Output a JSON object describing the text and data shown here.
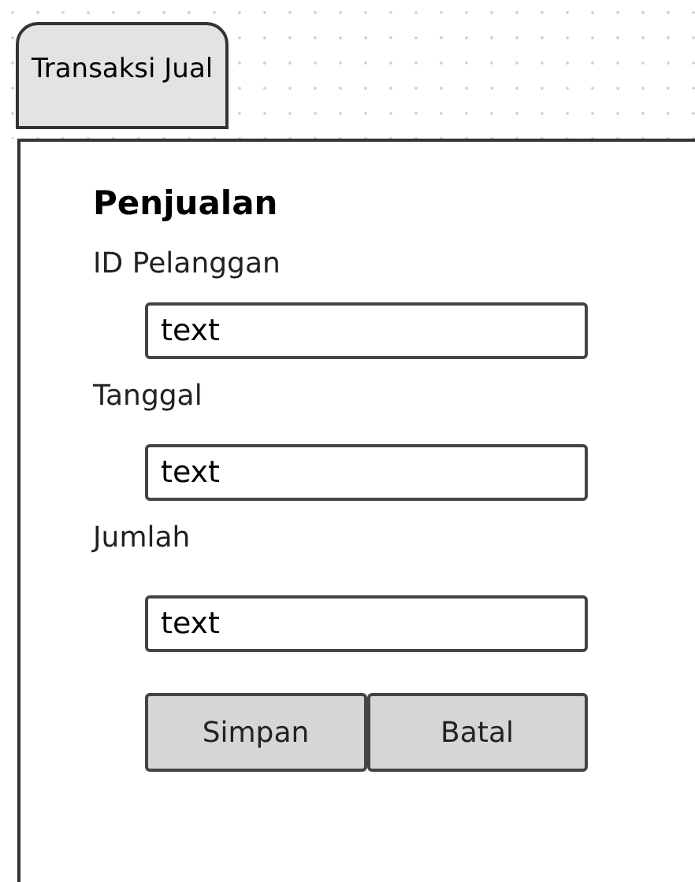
{
  "tabs": [
    {
      "label": "Transaksi Jual",
      "selected": true
    }
  ],
  "form": {
    "title": "Penjualan",
    "fields": [
      {
        "label": "ID Pelanggan",
        "value": "text"
      },
      {
        "label": "Tanggal",
        "value": "text"
      },
      {
        "label": "Jumlah",
        "value": "text"
      }
    ],
    "buttons": [
      "Simpan",
      "Batal"
    ]
  }
}
